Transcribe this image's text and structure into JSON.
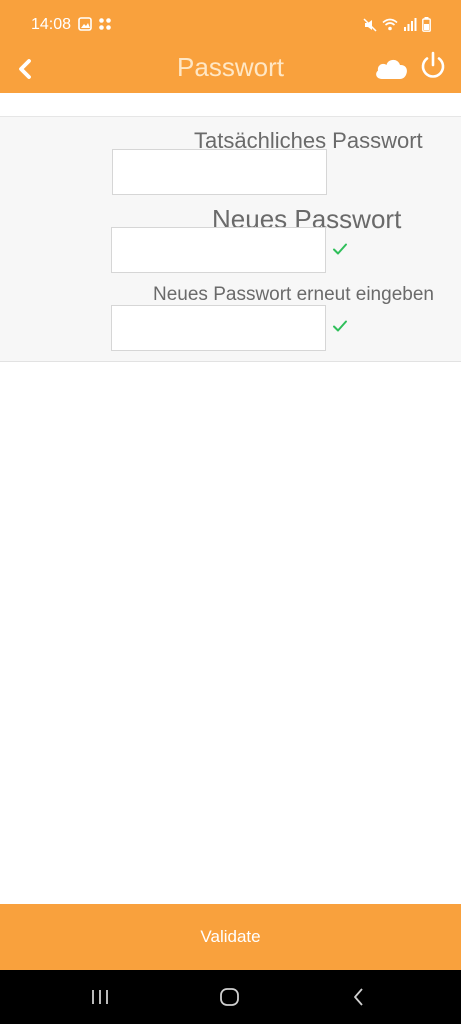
{
  "status_bar": {
    "time": "14:08",
    "left_icons": [
      "image-icon",
      "apps-grid-icon"
    ],
    "right_icons": [
      "mute-icon",
      "wifi-icon",
      "signal-icon",
      "battery-icon"
    ]
  },
  "app_bar": {
    "title": "Passwort",
    "back_icon": "chevron-left-icon",
    "actions": [
      "cloud-icon",
      "power-icon"
    ]
  },
  "form": {
    "current_password": {
      "label": "Tatsächliches Passwort",
      "value": ""
    },
    "new_password": {
      "label": "Neues Passwort",
      "value": "",
      "valid": true
    },
    "confirm_password": {
      "label": "Neues Passwort erneut eingeben",
      "value": "",
      "valid": true
    }
  },
  "validate_button": {
    "label": "Validate"
  },
  "nav_bar": {
    "buttons": [
      "recent-apps-icon",
      "home-icon",
      "back-icon"
    ]
  },
  "colors": {
    "accent": "#f9a13d",
    "check": "#2fbf5a",
    "panel": "#f7f7f7",
    "label_text": "#6a6a6a"
  }
}
